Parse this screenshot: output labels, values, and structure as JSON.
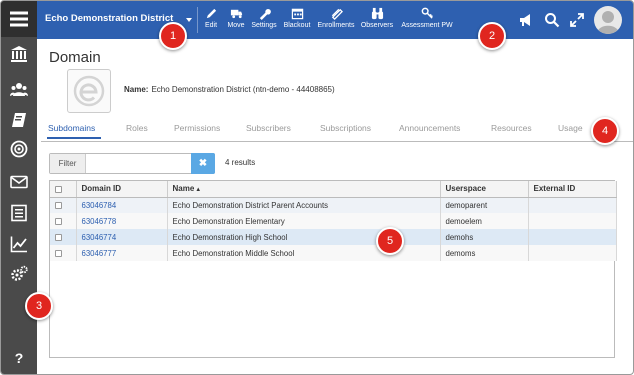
{
  "rail": {
    "menu_icon": "menu-icon",
    "help_label": "?",
    "items": [
      {
        "icon": "bank-icon"
      },
      {
        "icon": "users-icon"
      },
      {
        "icon": "book-icon"
      },
      {
        "icon": "target-icon"
      },
      {
        "icon": "mail-icon"
      },
      {
        "icon": "list-icon"
      },
      {
        "icon": "chart-icon"
      },
      {
        "icon": "gears-icon"
      }
    ]
  },
  "header": {
    "district": "Echo Demonstration District",
    "tools": [
      {
        "label": "Edit",
        "icon": "pencil-icon"
      },
      {
        "label": "Move",
        "icon": "truck-icon"
      },
      {
        "label": "Settings",
        "icon": "wrench-icon"
      },
      {
        "label": "Blackout",
        "icon": "calendar-icon"
      },
      {
        "label": "Enrollments",
        "icon": "ticket-icon"
      },
      {
        "label": "Observers",
        "icon": "binoculars-icon"
      },
      {
        "label": "Assessment PW",
        "icon": "key-icon"
      }
    ],
    "right_icons": [
      "megaphone-icon",
      "search-icon",
      "expand-icon",
      "avatar"
    ]
  },
  "domain": {
    "title": "Domain",
    "name_label": "Name:",
    "name_value": "Echo Demonstration District (ntn-demo - 44408865)"
  },
  "tabs": [
    "Subdomains",
    "Roles",
    "Permissions",
    "Subscribers",
    "Subscriptions",
    "Announcements",
    "Resources",
    "Usage"
  ],
  "active_tab": "Subdomains",
  "filter": {
    "label": "Filter",
    "value": "",
    "placeholder": "",
    "clear_label": "✖",
    "results": "4 results"
  },
  "table": {
    "columns": [
      "",
      "Domain ID",
      "Name",
      "Userspace",
      "External ID"
    ],
    "sort_indicator": "▲",
    "rows": [
      {
        "id": "63046784",
        "name": "Echo Demonstration District Parent Accounts",
        "userspace": "demoparent",
        "external": ""
      },
      {
        "id": "63046778",
        "name": "Echo Demonstration Elementary",
        "userspace": "demoelem",
        "external": ""
      },
      {
        "id": "63046774",
        "name": "Echo Demonstration High School",
        "userspace": "demohs",
        "external": ""
      },
      {
        "id": "63046777",
        "name": "Echo Demonstration Middle School",
        "userspace": "demoms",
        "external": ""
      }
    ]
  },
  "callouts": [
    "1",
    "2",
    "3",
    "4",
    "5"
  ],
  "colors": {
    "brand_blue": "#2e60b0",
    "rail": "#4a4a4a",
    "callout_red": "#e0261f",
    "clear_button": "#5aa8e4"
  }
}
